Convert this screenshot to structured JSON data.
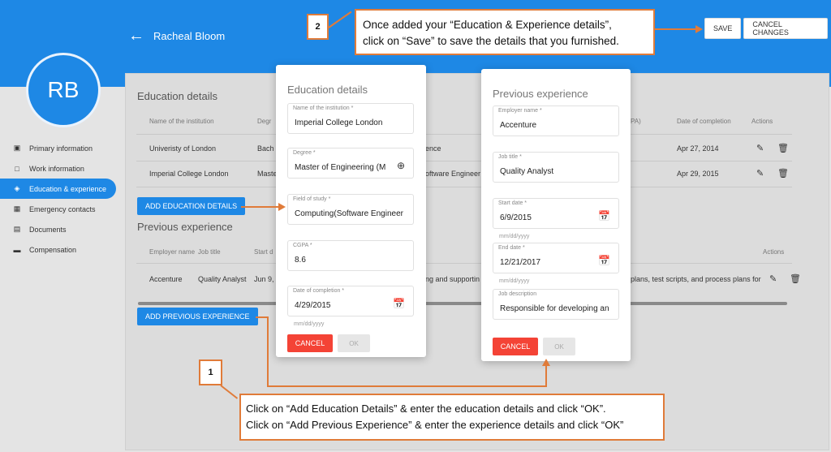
{
  "header": {
    "back_icon": "arrow-left-icon",
    "user_name": "Racheal Bloom",
    "save_label": "SAVE",
    "cancel_changes_label": "CANCEL CHANGES",
    "accent_color": "#1e88e5"
  },
  "avatar": {
    "initials": "RB"
  },
  "sidebar": {
    "items": [
      {
        "label": "Primary information",
        "icon": "id-card-icon",
        "active": false
      },
      {
        "label": "Work information",
        "icon": "briefcase-icon",
        "active": false
      },
      {
        "label": "Education & experience",
        "icon": "graduation-cap-icon",
        "active": true
      },
      {
        "label": "Emergency contacts",
        "icon": "contact-card-icon",
        "active": false
      },
      {
        "label": "Documents",
        "icon": "folder-icon",
        "active": false
      },
      {
        "label": "Compensation",
        "icon": "wallet-icon",
        "active": false
      }
    ]
  },
  "education": {
    "title": "Education details",
    "columns": {
      "institution": "Name of the institution",
      "degree": "Degr",
      "gpa": "PA)",
      "completion": "Date of completion",
      "actions": "Actions"
    },
    "rows": [
      {
        "institution": "Univeristy of London",
        "degree": "Bach",
        "field": "ence",
        "completion": "Apr 27, 2014"
      },
      {
        "institution": "Imperial College London",
        "degree": "Maste",
        "field": "oftware Engineer",
        "completion": "Apr 29, 2015"
      }
    ],
    "add_button": "ADD EDUCATION DETAILS"
  },
  "experience": {
    "title": "Previous experience",
    "columns": {
      "employer": "Employer name",
      "job": "Job title",
      "start": "Start d",
      "actions": "Actions"
    },
    "rows": [
      {
        "employer": "Accenture",
        "job": "Quality Analyst",
        "start": "Jun 9,",
        "desc_a": "ng and supportin",
        "desc_b": "plans, test scripts, and process plans for"
      }
    ],
    "add_button": "ADD PREVIOUS EXPERIENCE"
  },
  "education_modal": {
    "title": "Education details",
    "fields": [
      {
        "label": "Name of the institution *",
        "value": "Imperial College London"
      },
      {
        "label": "Degree *",
        "value": "Master of Engineering (M"
      },
      {
        "label": "Field of study *",
        "value": "Computing(Software Engineer"
      },
      {
        "label": "CGPA *",
        "value": "8.6"
      },
      {
        "label": "Date of completion *",
        "value": "4/29/2015"
      }
    ],
    "date_hint": "mm/dd/yyyy",
    "cancel_label": "CANCEL",
    "ok_label": "OK"
  },
  "experience_modal": {
    "title": "Previous experience",
    "fields": [
      {
        "label": "Employer name *",
        "value": "Accenture"
      },
      {
        "label": "Job title *",
        "value": "Quality Analyst"
      },
      {
        "label": "Start date *",
        "value": "6/9/2015"
      },
      {
        "label": "End date *",
        "value": "12/21/2017"
      },
      {
        "label": "Job description",
        "value": "Responsible for developing an"
      }
    ],
    "date_hint_1": "mm/dd/yyyy",
    "date_hint_2": "mm/dd/yyyy",
    "cancel_label": "CANCEL",
    "ok_label": "OK"
  },
  "callouts": {
    "step1_number": "1",
    "step1_line1": "Click on “Add Education Details” & enter the education details and click “OK”.",
    "step1_line2": "Click on “Add Previous Experience” & enter the experience details and click “OK”",
    "step2_number": "2",
    "step2_line1": "Once added your “Education & Experience details”,",
    "step2_line2": "click on “Save” to save the details that you furnished.",
    "callout_color": "#e07b39"
  }
}
